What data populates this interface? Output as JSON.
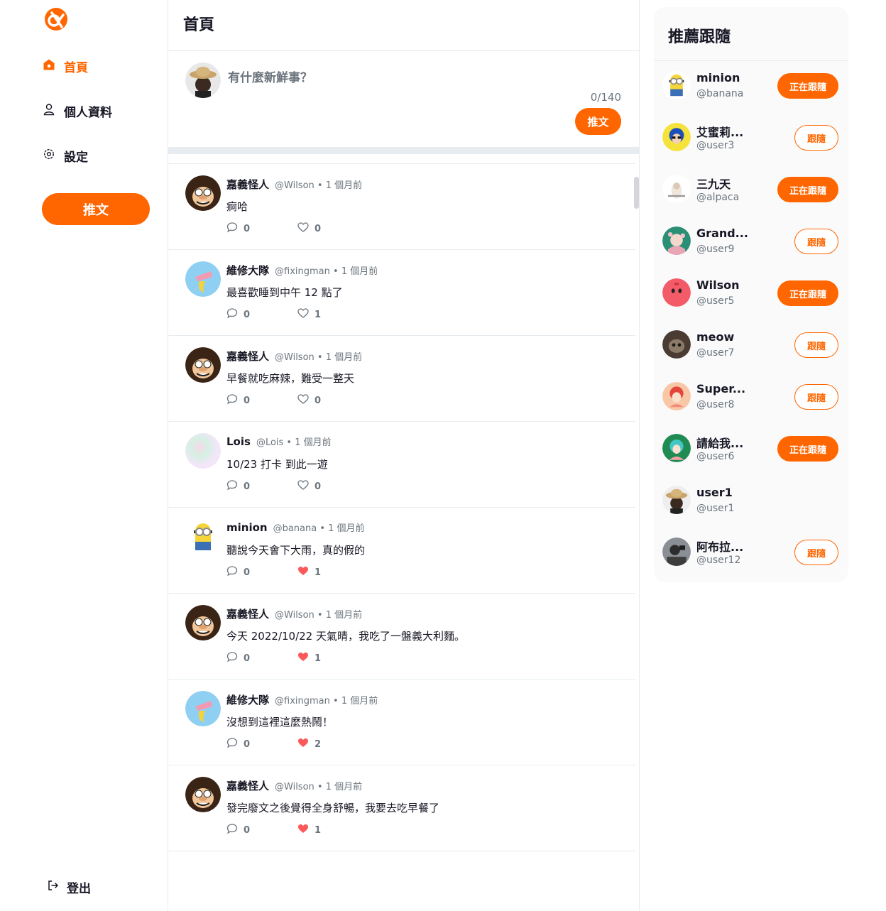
{
  "colors": {
    "accent": "#FF6600",
    "text": "#171725",
    "muted": "#6C757D",
    "border": "#E6ECF0",
    "like": "#FC5A5A"
  },
  "nav": {
    "items": [
      {
        "label": "首頁",
        "icon": "home-icon",
        "active": true
      },
      {
        "label": "個人資料",
        "icon": "user-icon",
        "active": false
      },
      {
        "label": "設定",
        "icon": "gear-icon",
        "active": false
      }
    ],
    "tweet_button": "推文",
    "logout": "登出"
  },
  "main": {
    "title": "首頁",
    "compose": {
      "placeholder": "有什麼新鮮事？",
      "count": "0/140",
      "button": "推文"
    },
    "tweets": [
      {
        "name": "嘉義怪人",
        "handle": "@Wilson",
        "time": "1 個月前",
        "text": "痾哈",
        "replies": "0",
        "likes": "0",
        "liked": false,
        "avatar": "wilson"
      },
      {
        "name": "維修大隊",
        "handle": "@fixingman",
        "time": "1 個月前",
        "text": "最喜歡睡到中午 12 點了",
        "replies": "0",
        "likes": "1",
        "liked": false,
        "avatar": "banana"
      },
      {
        "name": "嘉義怪人",
        "handle": "@Wilson",
        "time": "1 個月前",
        "text": "早餐就吃麻辣，難受一整天",
        "replies": "0",
        "likes": "0",
        "liked": false,
        "avatar": "wilson"
      },
      {
        "name": "Lois",
        "handle": "@Lois",
        "time": "1 個月前",
        "text": "10/23 打卡 到此一遊",
        "replies": "0",
        "likes": "0",
        "liked": false,
        "avatar": "pastel"
      },
      {
        "name": "minion",
        "handle": "@banana",
        "time": "1 個月前",
        "text": "聽說今天會下大雨，真的假的",
        "replies": "0",
        "likes": "1",
        "liked": true,
        "avatar": "minion"
      },
      {
        "name": "嘉義怪人",
        "handle": "@Wilson",
        "time": "1 個月前",
        "text": "今天 2022/10/22 天氣晴，我吃了一盤義大利麵。",
        "replies": "0",
        "likes": "1",
        "liked": true,
        "avatar": "wilson"
      },
      {
        "name": "維修大隊",
        "handle": "@fixingman",
        "time": "1 個月前",
        "text": "沒想到這裡這麼熱鬧！",
        "replies": "0",
        "likes": "2",
        "liked": true,
        "avatar": "banana"
      },
      {
        "name": "嘉義怪人",
        "handle": "@Wilson",
        "time": "1 個月前",
        "text": "發完廢文之後覺得全身舒暢，我要去吃早餐了",
        "replies": "0",
        "likes": "1",
        "liked": true,
        "avatar": "wilson"
      }
    ]
  },
  "recommend": {
    "title": "推薦跟隨",
    "following_label": "正在跟隨",
    "follow_label": "跟隨",
    "users": [
      {
        "name": "minion",
        "handle": "@banana",
        "status": "following",
        "avatar": "minion"
      },
      {
        "name": "艾蜜莉...",
        "handle": "@user3",
        "status": "follow",
        "avatar": "emily"
      },
      {
        "name": "三九天",
        "handle": "@alpaca",
        "status": "following",
        "avatar": "alpaca"
      },
      {
        "name": "Grand...",
        "handle": "@user9",
        "status": "follow",
        "avatar": "grand"
      },
      {
        "name": "Wilson",
        "handle": "@user5",
        "status": "following",
        "avatar": "redball"
      },
      {
        "name": "meow",
        "handle": "@user7",
        "status": "follow",
        "avatar": "cat"
      },
      {
        "name": "Super...",
        "handle": "@user8",
        "status": "follow",
        "avatar": "super"
      },
      {
        "name": "請給我...",
        "handle": "@user6",
        "status": "following",
        "avatar": "teal"
      },
      {
        "name": "user1",
        "handle": "@user1",
        "status": "none",
        "avatar": "hat"
      },
      {
        "name": "阿布拉...",
        "handle": "@user12",
        "status": "follow",
        "avatar": "photo"
      }
    ]
  }
}
